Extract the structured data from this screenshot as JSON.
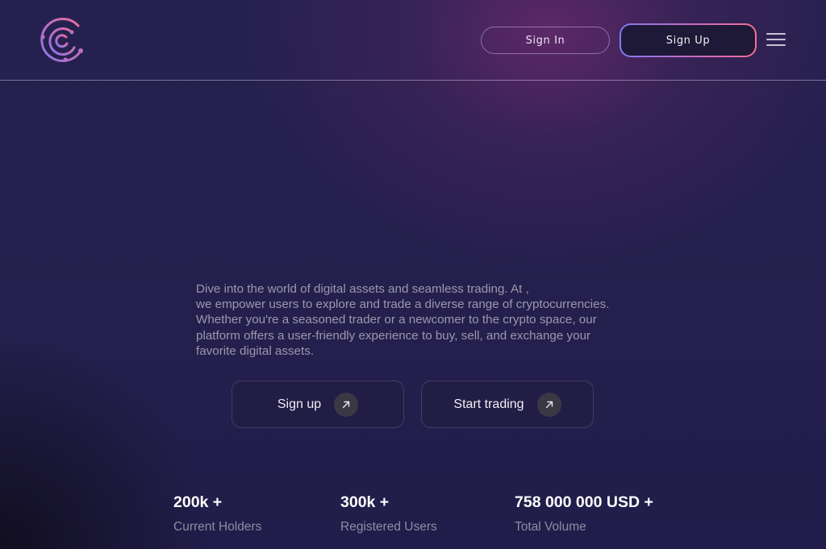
{
  "header": {
    "logo_icon": "crypto-c-circuit-logo",
    "sign_in_label": "Sign In",
    "sign_up_label": "Sign Up",
    "menu_icon": "hamburger-menu-icon"
  },
  "hero": {
    "description_lines": [
      "Dive into the world of digital assets and seamless trading. At ,",
      "we empower users to explore and trade a diverse range of cryptocurrencies.",
      "Whether you're a seasoned trader or a newcomer to the crypto space, our",
      "platform offers a user-friendly experience to buy, sell, and exchange your",
      "favorite digital assets."
    ],
    "buttons": [
      {
        "label": "Sign up",
        "icon": "arrow-up-right-icon"
      },
      {
        "label": "Start trading",
        "icon": "arrow-up-right-icon"
      }
    ]
  },
  "stats": [
    {
      "value": "200k +",
      "caption": "Current Holders"
    },
    {
      "value": "300k +",
      "caption": "Registered Users"
    },
    {
      "value": "758 000 000 USD +",
      "caption": "Total Volume"
    }
  ],
  "colors": {
    "background": "#231f4a",
    "glow": "#6e2a70",
    "gradient_start": "#7d7cf2",
    "gradient_end": "#f26f95",
    "muted_text": "#9c98ad"
  }
}
